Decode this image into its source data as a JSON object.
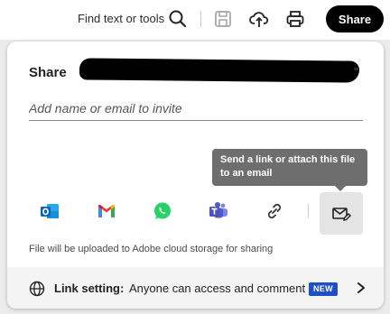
{
  "toolbar": {
    "find_text": "Find text or tools",
    "share_label": "Share",
    "icons": [
      "search-icon",
      "save-icon",
      "cloud-upload-icon",
      "print-icon"
    ]
  },
  "share_panel": {
    "title": "Share",
    "title_trailing": "\"",
    "invite_placeholder": "Add name or email to invite",
    "tooltip": "Send a link or attach this file to an email",
    "apps": [
      "outlook-icon",
      "gmail-icon",
      "whatsapp-icon",
      "teams-icon",
      "link-icon"
    ],
    "upload_note": "File will be uploaded to Adobe cloud storage for sharing",
    "link_setting": {
      "label": "Link setting:",
      "value": "Anyone can access and comment",
      "badge": "NEW"
    }
  },
  "colors": {
    "accent_badge": "#1f4fc4",
    "share_button": "#000000",
    "tooltip_bg": "#6e6e6e"
  }
}
